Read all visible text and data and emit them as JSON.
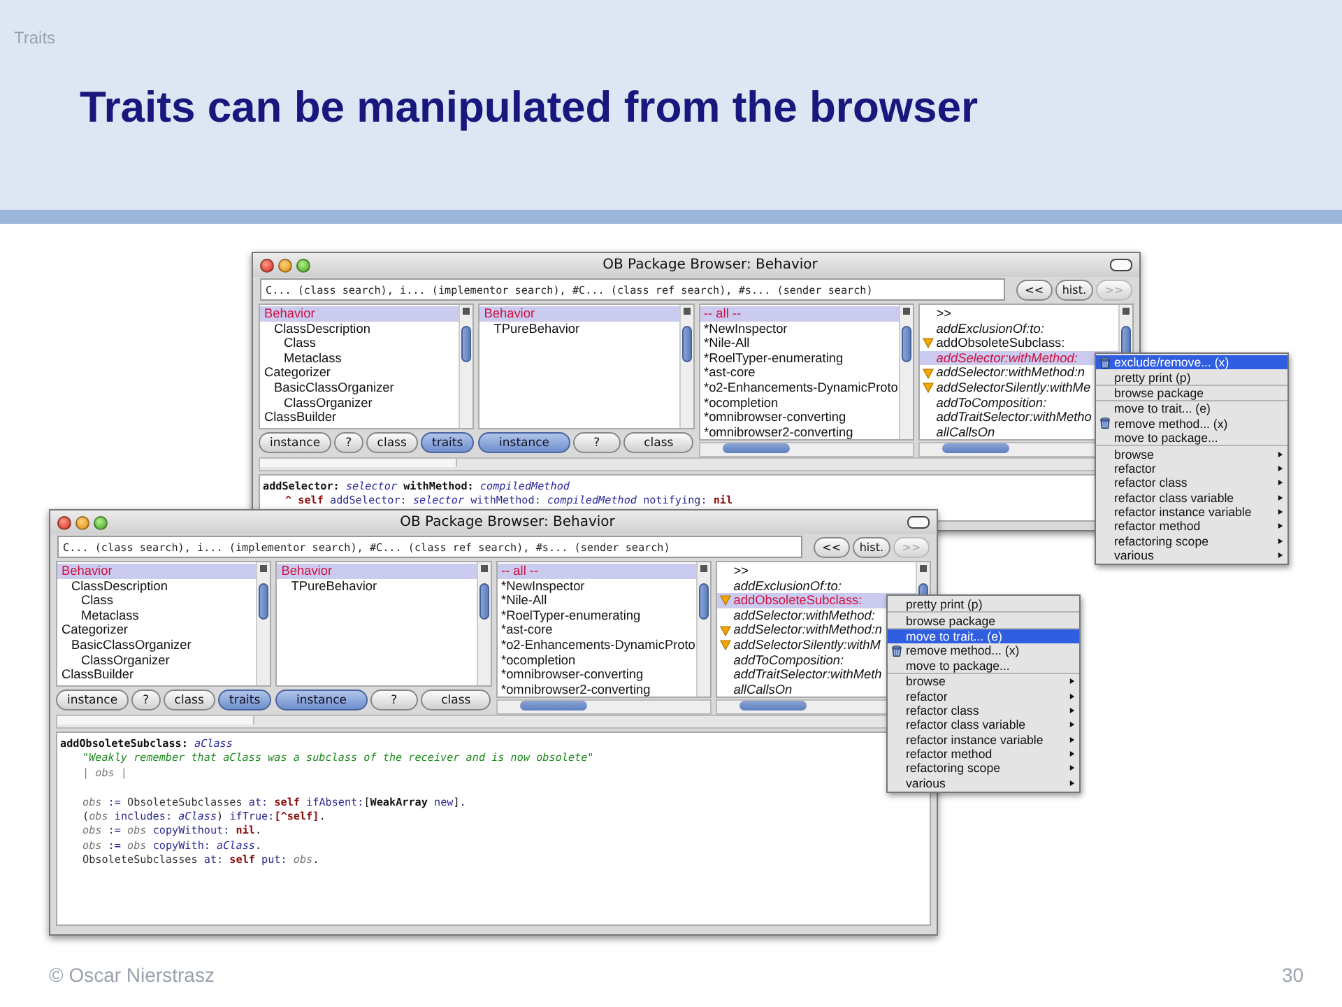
{
  "slide": {
    "section": "Traits",
    "title": "Traits can be manipulated from the browser",
    "footer": "© Oscar Nierstrasz",
    "page": "30"
  },
  "windows": [
    {
      "title": "OB Package Browser: Behavior",
      "search": {
        "placeholder": "C... (class search), i... (implementor search), #C... (class ref search), #s... (sender search)"
      },
      "nav_buttons": [
        {
          "label": "<<",
          "disabled": false
        },
        {
          "label": "hist.",
          "disabled": false
        },
        {
          "label": ">>",
          "disabled": true
        }
      ],
      "panes": [
        {
          "items": [
            {
              "label": "Behavior",
              "selected": true,
              "children": [
                {
                  "label": "ClassDescription",
                  "selected": false,
                  "children": [
                    {
                      "label": "Class",
                      "selected": false
                    },
                    {
                      "label": "Metaclass",
                      "selected": false
                    }
                  ]
                }
              ]
            },
            {
              "label": "Categorizer",
              "selected": false,
              "children": [
                {
                  "label": "BasicClassOrganizer",
                  "selected": false,
                  "children": [
                    {
                      "label": "ClassOrganizer",
                      "selected": false
                    }
                  ]
                }
              ]
            },
            {
              "label": "ClassBuilder",
              "selected": false
            }
          ],
          "buttons": [
            {
              "label": "instance",
              "selected": false
            },
            {
              "label": "?",
              "selected": false
            },
            {
              "label": "class",
              "selected": false
            },
            {
              "label": "traits",
              "selected": true
            }
          ]
        },
        {
          "items": [
            {
              "label": "Behavior",
              "selected": true,
              "children": [
                {
                  "label": "TPureBehavior",
                  "selected": false
                }
              ]
            }
          ],
          "buttons": [
            {
              "label": "instance",
              "selected": true
            },
            {
              "label": "?",
              "selected": false
            },
            {
              "label": "class",
              "selected": false
            }
          ]
        },
        {
          "items": [
            {
              "label": "-- all --",
              "selected": true
            },
            {
              "label": "*NewInspector",
              "selected": false
            },
            {
              "label": "*Nile-All",
              "selected": false
            },
            {
              "label": "*RoelTyper-enumerating",
              "selected": false
            },
            {
              "label": "*ast-core",
              "selected": false
            },
            {
              "label": "*o2-Enhancements-DynamicProto",
              "selected": false
            },
            {
              "label": "*ocompletion",
              "selected": false
            },
            {
              "label": "*omnibrowser-converting",
              "selected": false
            },
            {
              "label": "*omnibrowser2-converting",
              "selected": false
            }
          ]
        },
        {
          "items": [
            {
              "label": ">>",
              "selected": false,
              "flagged": false
            },
            {
              "label": "addExclusionOf:to:",
              "selected": false,
              "flagged": false,
              "from_trait": true
            },
            {
              "label": "addObsoleteSubclass:",
              "selected": false,
              "flagged": true,
              "from_trait": false
            },
            {
              "label": "addSelector:withMethod:",
              "selected": true,
              "flagged": false,
              "from_trait": true
            },
            {
              "label": "addSelector:withMethod:n",
              "selected": false,
              "flagged": true,
              "from_trait": true
            },
            {
              "label": "addSelectorSilently:withMe",
              "selected": false,
              "flagged": true,
              "from_trait": true
            },
            {
              "label": "addToComposition:",
              "selected": false,
              "flagged": false,
              "from_trait": true
            },
            {
              "label": "addTraitSelector:withMetho",
              "selected": false,
              "flagged": false,
              "from_trait": true
            },
            {
              "label": "allCallsOn",
              "selected": false,
              "flagged": false,
              "from_trait": true
            }
          ]
        }
      ],
      "code": [
        {
          "kind": "header",
          "tokens": [
            {
              "text": "addSelector: ",
              "kind": "selector"
            },
            {
              "text": "selector ",
              "kind": "arg"
            },
            {
              "text": "withMethod: ",
              "kind": "selector"
            },
            {
              "text": "compiledMethod",
              "kind": "arg"
            }
          ]
        },
        {
          "kind": "body",
          "tokens": [
            {
              "text": "^ self ",
              "kind": "pseudo"
            },
            {
              "text": "addSelector: ",
              "kind": "message"
            },
            {
              "text": "selector ",
              "kind": "arg"
            },
            {
              "text": "withMethod: ",
              "kind": "message"
            },
            {
              "text": "compiledMethod ",
              "kind": "arg"
            },
            {
              "text": "notifying: ",
              "kind": "message"
            },
            {
              "text": "nil",
              "kind": "pseudo"
            }
          ]
        }
      ]
    },
    {
      "title": "OB Package Browser: Behavior",
      "search": {
        "placeholder": "C... (class search), i... (implementor search), #C... (class ref search), #s... (sender search)"
      },
      "nav_buttons": [
        {
          "label": "<<",
          "disabled": false
        },
        {
          "label": "hist.",
          "disabled": false
        },
        {
          "label": ">>",
          "disabled": true
        }
      ],
      "panes": [
        {
          "items": [
            {
              "label": "Behavior",
              "selected": true,
              "children": [
                {
                  "label": "ClassDescription",
                  "selected": false,
                  "children": [
                    {
                      "label": "Class",
                      "selected": false
                    },
                    {
                      "label": "Metaclass",
                      "selected": false
                    }
                  ]
                }
              ]
            },
            {
              "label": "Categorizer",
              "selected": false,
              "children": [
                {
                  "label": "BasicClassOrganizer",
                  "selected": false,
                  "children": [
                    {
                      "label": "ClassOrganizer",
                      "selected": false
                    }
                  ]
                }
              ]
            },
            {
              "label": "ClassBuilder",
              "selected": false
            }
          ],
          "buttons": [
            {
              "label": "instance",
              "selected": false
            },
            {
              "label": "?",
              "selected": false
            },
            {
              "label": "class",
              "selected": false
            },
            {
              "label": "traits",
              "selected": true
            }
          ]
        },
        {
          "items": [
            {
              "label": "Behavior",
              "selected": true,
              "children": [
                {
                  "label": "TPureBehavior",
                  "selected": false
                }
              ]
            }
          ],
          "buttons": [
            {
              "label": "instance",
              "selected": true
            },
            {
              "label": "?",
              "selected": false
            },
            {
              "label": "class",
              "selected": false
            }
          ]
        },
        {
          "items": [
            {
              "label": "-- all --",
              "selected": true
            },
            {
              "label": "*NewInspector",
              "selected": false
            },
            {
              "label": "*Nile-All",
              "selected": false
            },
            {
              "label": "*RoelTyper-enumerating",
              "selected": false
            },
            {
              "label": "*ast-core",
              "selected": false
            },
            {
              "label": "*o2-Enhancements-DynamicProto",
              "selected": false
            },
            {
              "label": "*ocompletion",
              "selected": false
            },
            {
              "label": "*omnibrowser-converting",
              "selected": false
            },
            {
              "label": "*omnibrowser2-converting",
              "selected": false
            }
          ]
        },
        {
          "items": [
            {
              "label": ">>",
              "selected": false,
              "flagged": false
            },
            {
              "label": "addExclusionOf:to:",
              "selected": false,
              "flagged": false,
              "from_trait": true
            },
            {
              "label": "addObsoleteSubclass:",
              "selected": true,
              "flagged": true,
              "from_trait": false
            },
            {
              "label": "addSelector:withMethod:",
              "selected": false,
              "flagged": false,
              "from_trait": true
            },
            {
              "label": "addSelector:withMethod:n",
              "selected": false,
              "flagged": true,
              "from_trait": true
            },
            {
              "label": "addSelectorSilently:withM",
              "selected": false,
              "flagged": true,
              "from_trait": true
            },
            {
              "label": "addToComposition:",
              "selected": false,
              "flagged": false,
              "from_trait": true
            },
            {
              "label": "addTraitSelector:withMeth",
              "selected": false,
              "flagged": false,
              "from_trait": true
            },
            {
              "label": "allCallsOn",
              "selected": false,
              "flagged": false,
              "from_trait": true
            }
          ]
        }
      ],
      "code": [
        {
          "kind": "header",
          "tokens": [
            {
              "text": "addObsoleteSubclass: ",
              "kind": "selector"
            },
            {
              "text": "aClass",
              "kind": "arg"
            }
          ]
        },
        {
          "kind": "body",
          "tokens": [
            {
              "text": "\"Weakly remember that aClass was a subclass of the receiver and is now obsolete\"",
              "kind": "comment"
            }
          ]
        },
        {
          "kind": "body",
          "tokens": [
            {
              "text": "| obs |",
              "kind": "temp"
            }
          ]
        },
        {
          "kind": "blank"
        },
        {
          "kind": "body",
          "tokens": [
            {
              "text": "obs ",
              "kind": "temp"
            },
            {
              "text": ":= ",
              "kind": "message"
            },
            {
              "text": "ObsoleteSubclasses ",
              "kind": "global"
            },
            {
              "text": "at: ",
              "kind": "message"
            },
            {
              "text": "self ",
              "kind": "pseudo"
            },
            {
              "text": "ifAbsent:",
              "kind": "message"
            },
            {
              "text": "[",
              "kind": "plain"
            },
            {
              "text": "WeakArray ",
              "kind": "selector"
            },
            {
              "text": "new",
              "kind": "message"
            },
            {
              "text": "].",
              "kind": "plain"
            }
          ]
        },
        {
          "kind": "body",
          "tokens": [
            {
              "text": "(",
              "kind": "plain"
            },
            {
              "text": "obs ",
              "kind": "temp"
            },
            {
              "text": "includes: ",
              "kind": "message"
            },
            {
              "text": "aClass",
              "kind": "arg"
            },
            {
              "text": ") ",
              "kind": "plain"
            },
            {
              "text": "ifTrue:",
              "kind": "message"
            },
            {
              "text": "[^self]",
              "kind": "pseudo"
            },
            {
              "text": ".",
              "kind": "plain"
            }
          ]
        },
        {
          "kind": "body",
          "tokens": [
            {
              "text": "obs ",
              "kind": "temp"
            },
            {
              "text": ":= ",
              "kind": "message"
            },
            {
              "text": "obs ",
              "kind": "temp"
            },
            {
              "text": "copyWithout: ",
              "kind": "message"
            },
            {
              "text": "nil",
              "kind": "pseudo"
            },
            {
              "text": ".",
              "kind": "plain"
            }
          ]
        },
        {
          "kind": "body",
          "tokens": [
            {
              "text": "obs ",
              "kind": "temp"
            },
            {
              "text": ":= ",
              "kind": "message"
            },
            {
              "text": "obs ",
              "kind": "temp"
            },
            {
              "text": "copyWith: ",
              "kind": "message"
            },
            {
              "text": "aClass",
              "kind": "arg"
            },
            {
              "text": ".",
              "kind": "plain"
            }
          ]
        },
        {
          "kind": "body",
          "tokens": [
            {
              "text": "ObsoleteSubclasses ",
              "kind": "global"
            },
            {
              "text": "at: ",
              "kind": "message"
            },
            {
              "text": "self ",
              "kind": "pseudo"
            },
            {
              "text": "put: ",
              "kind": "message"
            },
            {
              "text": "obs",
              "kind": "temp"
            },
            {
              "text": ".",
              "kind": "plain"
            }
          ]
        }
      ]
    }
  ],
  "menus": [
    {
      "groups": [
        [
          {
            "label": "exclude/remove... (x)",
            "selected": true,
            "icon": true,
            "submenu": false
          },
          {
            "label": "pretty print (p)",
            "selected": false,
            "icon": false,
            "submenu": false
          }
        ],
        [
          {
            "label": "browse package",
            "selected": false,
            "icon": false,
            "submenu": false
          }
        ],
        [
          {
            "label": "move to trait... (e)",
            "selected": false,
            "icon": false,
            "submenu": false
          },
          {
            "label": "remove method... (x)",
            "selected": false,
            "icon": true,
            "submenu": false
          },
          {
            "label": "move to package...",
            "selected": false,
            "icon": false,
            "submenu": false
          }
        ],
        [
          {
            "label": "browse",
            "selected": false,
            "icon": false,
            "submenu": true
          },
          {
            "label": "refactor",
            "selected": false,
            "icon": false,
            "submenu": true
          },
          {
            "label": "refactor class",
            "selected": false,
            "icon": false,
            "submenu": true
          },
          {
            "label": "refactor class variable",
            "selected": false,
            "icon": false,
            "submenu": true
          },
          {
            "label": "refactor instance variable",
            "selected": false,
            "icon": false,
            "submenu": true
          },
          {
            "label": "refactor method",
            "selected": false,
            "icon": false,
            "submenu": true
          },
          {
            "label": "refactoring scope",
            "selected": false,
            "icon": false,
            "submenu": true
          },
          {
            "label": "various",
            "selected": false,
            "icon": false,
            "submenu": true
          }
        ]
      ]
    },
    {
      "groups": [
        [
          {
            "label": "pretty print (p)",
            "selected": false,
            "icon": false,
            "submenu": false
          }
        ],
        [
          {
            "label": "browse package",
            "selected": false,
            "icon": false,
            "submenu": false
          }
        ],
        [
          {
            "label": "move to trait... (e)",
            "selected": true,
            "icon": false,
            "submenu": false
          },
          {
            "label": "remove method... (x)",
            "selected": false,
            "icon": true,
            "submenu": false
          },
          {
            "label": "move to package...",
            "selected": false,
            "icon": false,
            "submenu": false
          }
        ],
        [
          {
            "label": "browse",
            "selected": false,
            "icon": false,
            "submenu": true
          },
          {
            "label": "refactor",
            "selected": false,
            "icon": false,
            "submenu": true
          },
          {
            "label": "refactor class",
            "selected": false,
            "icon": false,
            "submenu": true
          },
          {
            "label": "refactor class variable",
            "selected": false,
            "icon": false,
            "submenu": true
          },
          {
            "label": "refactor instance variable",
            "selected": false,
            "icon": false,
            "submenu": true
          },
          {
            "label": "refactor method",
            "selected": false,
            "icon": false,
            "submenu": true
          },
          {
            "label": "refactoring scope",
            "selected": false,
            "icon": false,
            "submenu": true
          },
          {
            "label": "various",
            "selected": false,
            "icon": false,
            "submenu": true
          }
        ]
      ]
    }
  ]
}
